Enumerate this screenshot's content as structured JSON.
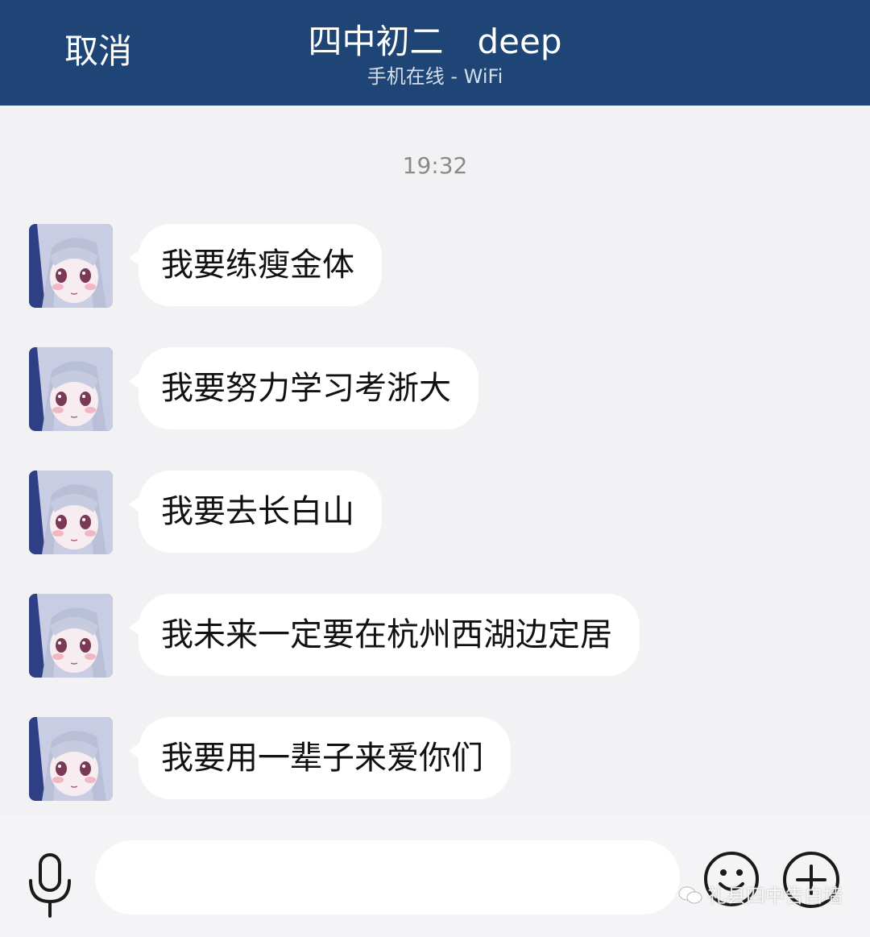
{
  "header": {
    "cancel_label": "取消",
    "title": "四中初二　deep",
    "subtitle": "手机在线 - WiFi",
    "background_color": "#1e4576"
  },
  "chat": {
    "timestamp": "19:32",
    "messages": [
      {
        "text": "我要练瘦金体"
      },
      {
        "text": "我要努力学习考浙大"
      },
      {
        "text": "我要去长白山"
      },
      {
        "text": "我未来一定要在杭州西湖边定居"
      },
      {
        "text": "我要用一辈子来爱你们"
      }
    ]
  },
  "input_bar": {
    "mic_icon": "microphone-icon",
    "input_value": "",
    "emoji_icon": "smiley-icon",
    "plus_icon": "plus-circle-icon"
  },
  "watermark": {
    "text": "礼县四中告白墙"
  }
}
